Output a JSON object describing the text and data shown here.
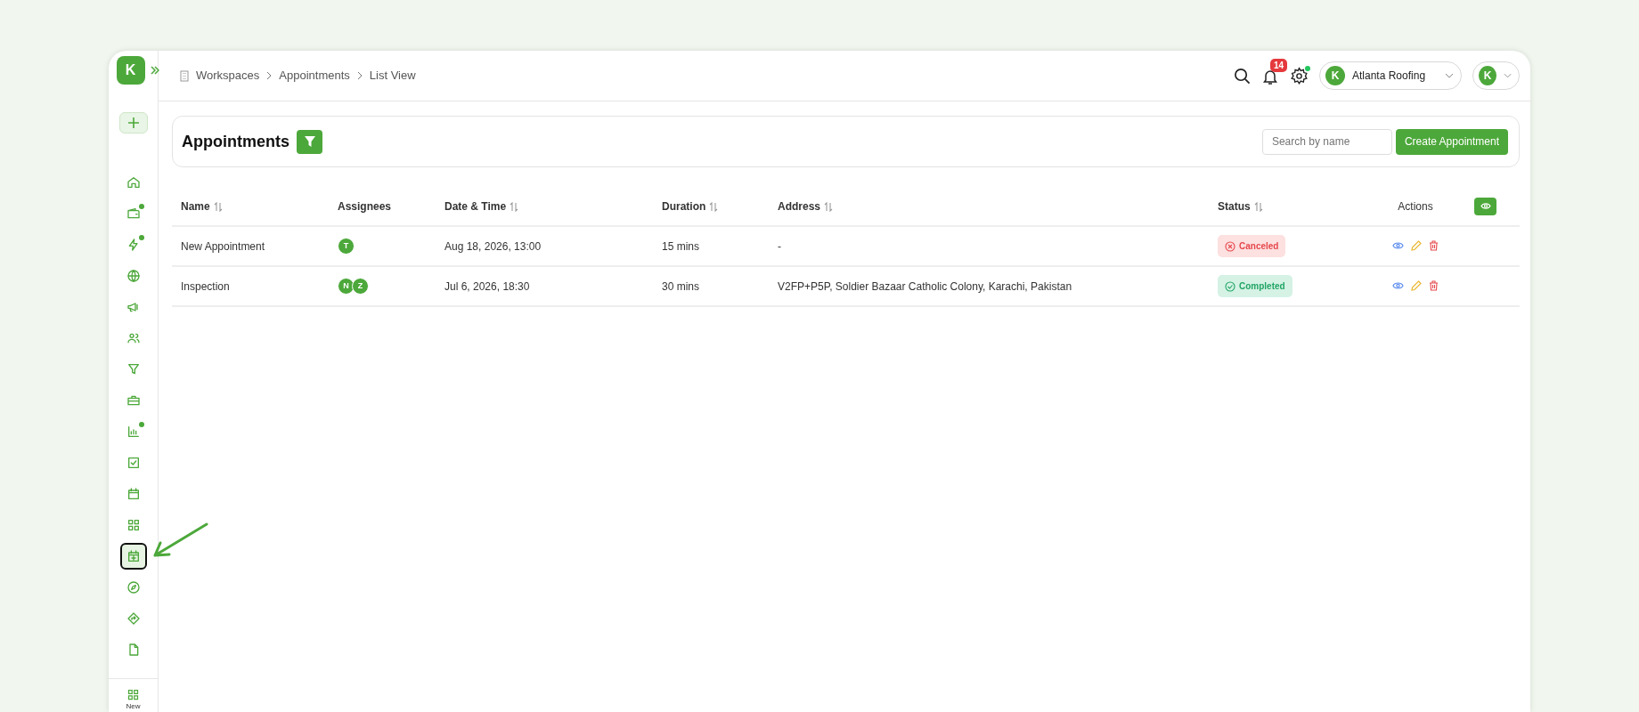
{
  "sidebar": {
    "logo": "K",
    "items": [
      {
        "kind": "home",
        "dot": false,
        "selected": false
      },
      {
        "kind": "wallet",
        "dot": true,
        "selected": false
      },
      {
        "kind": "bolt",
        "dot": true,
        "selected": false
      },
      {
        "kind": "globe",
        "dot": false,
        "selected": false
      },
      {
        "kind": "megaphone",
        "dot": false,
        "selected": false
      },
      {
        "kind": "users",
        "dot": false,
        "selected": false
      },
      {
        "kind": "funnel",
        "dot": false,
        "selected": false
      },
      {
        "kind": "briefcase",
        "dot": false,
        "selected": false
      },
      {
        "kind": "chart",
        "dot": true,
        "selected": false
      },
      {
        "kind": "checkbox",
        "dot": false,
        "selected": false
      },
      {
        "kind": "calendar",
        "dot": false,
        "selected": false
      },
      {
        "kind": "grid",
        "dot": false,
        "selected": false
      },
      {
        "kind": "calendar-plus",
        "dot": false,
        "selected": true
      },
      {
        "kind": "compass",
        "dot": false,
        "selected": false
      },
      {
        "kind": "sign",
        "dot": false,
        "selected": false
      },
      {
        "kind": "file",
        "dot": false,
        "selected": false
      }
    ],
    "bottom_label": "New"
  },
  "breadcrumbs": [
    "Workspaces",
    "Appointments",
    "List View"
  ],
  "header": {
    "notifications": "14",
    "settings_dot": true,
    "workspace": {
      "logo": "K",
      "name": "Atlanta Roofing"
    },
    "profile": {
      "logo": "K"
    }
  },
  "page": {
    "title": "Appointments",
    "search": {
      "placeholder": "Search by name"
    },
    "create_button": "Create Appointment"
  },
  "table": {
    "columns": [
      {
        "label": "Name",
        "sortable": true
      },
      {
        "label": "Assignees",
        "sortable": false
      },
      {
        "label": "Date & Time",
        "sortable": true
      },
      {
        "label": "Duration",
        "sortable": true
      },
      {
        "label": "Address",
        "sortable": true
      },
      {
        "label": "Status",
        "sortable": true
      },
      {
        "label": "Actions",
        "sortable": false
      }
    ],
    "rows": [
      {
        "name": "New Appointment",
        "assignees": [
          "T"
        ],
        "date_time": "Aug 18, 2026, 13:00",
        "duration": "15 mins",
        "address": "-",
        "status": {
          "kind": "canceled",
          "label": "Canceled"
        }
      },
      {
        "name": "Inspection",
        "assignees": [
          "N",
          "Z"
        ],
        "date_time": "Jul 6, 2026, 18:30",
        "duration": "30 mins",
        "address": "V2FP+P5P, Soldier Bazaar Catholic Colony, Karachi, Pakistan",
        "status": {
          "kind": "completed",
          "label": "Completed"
        }
      }
    ]
  }
}
